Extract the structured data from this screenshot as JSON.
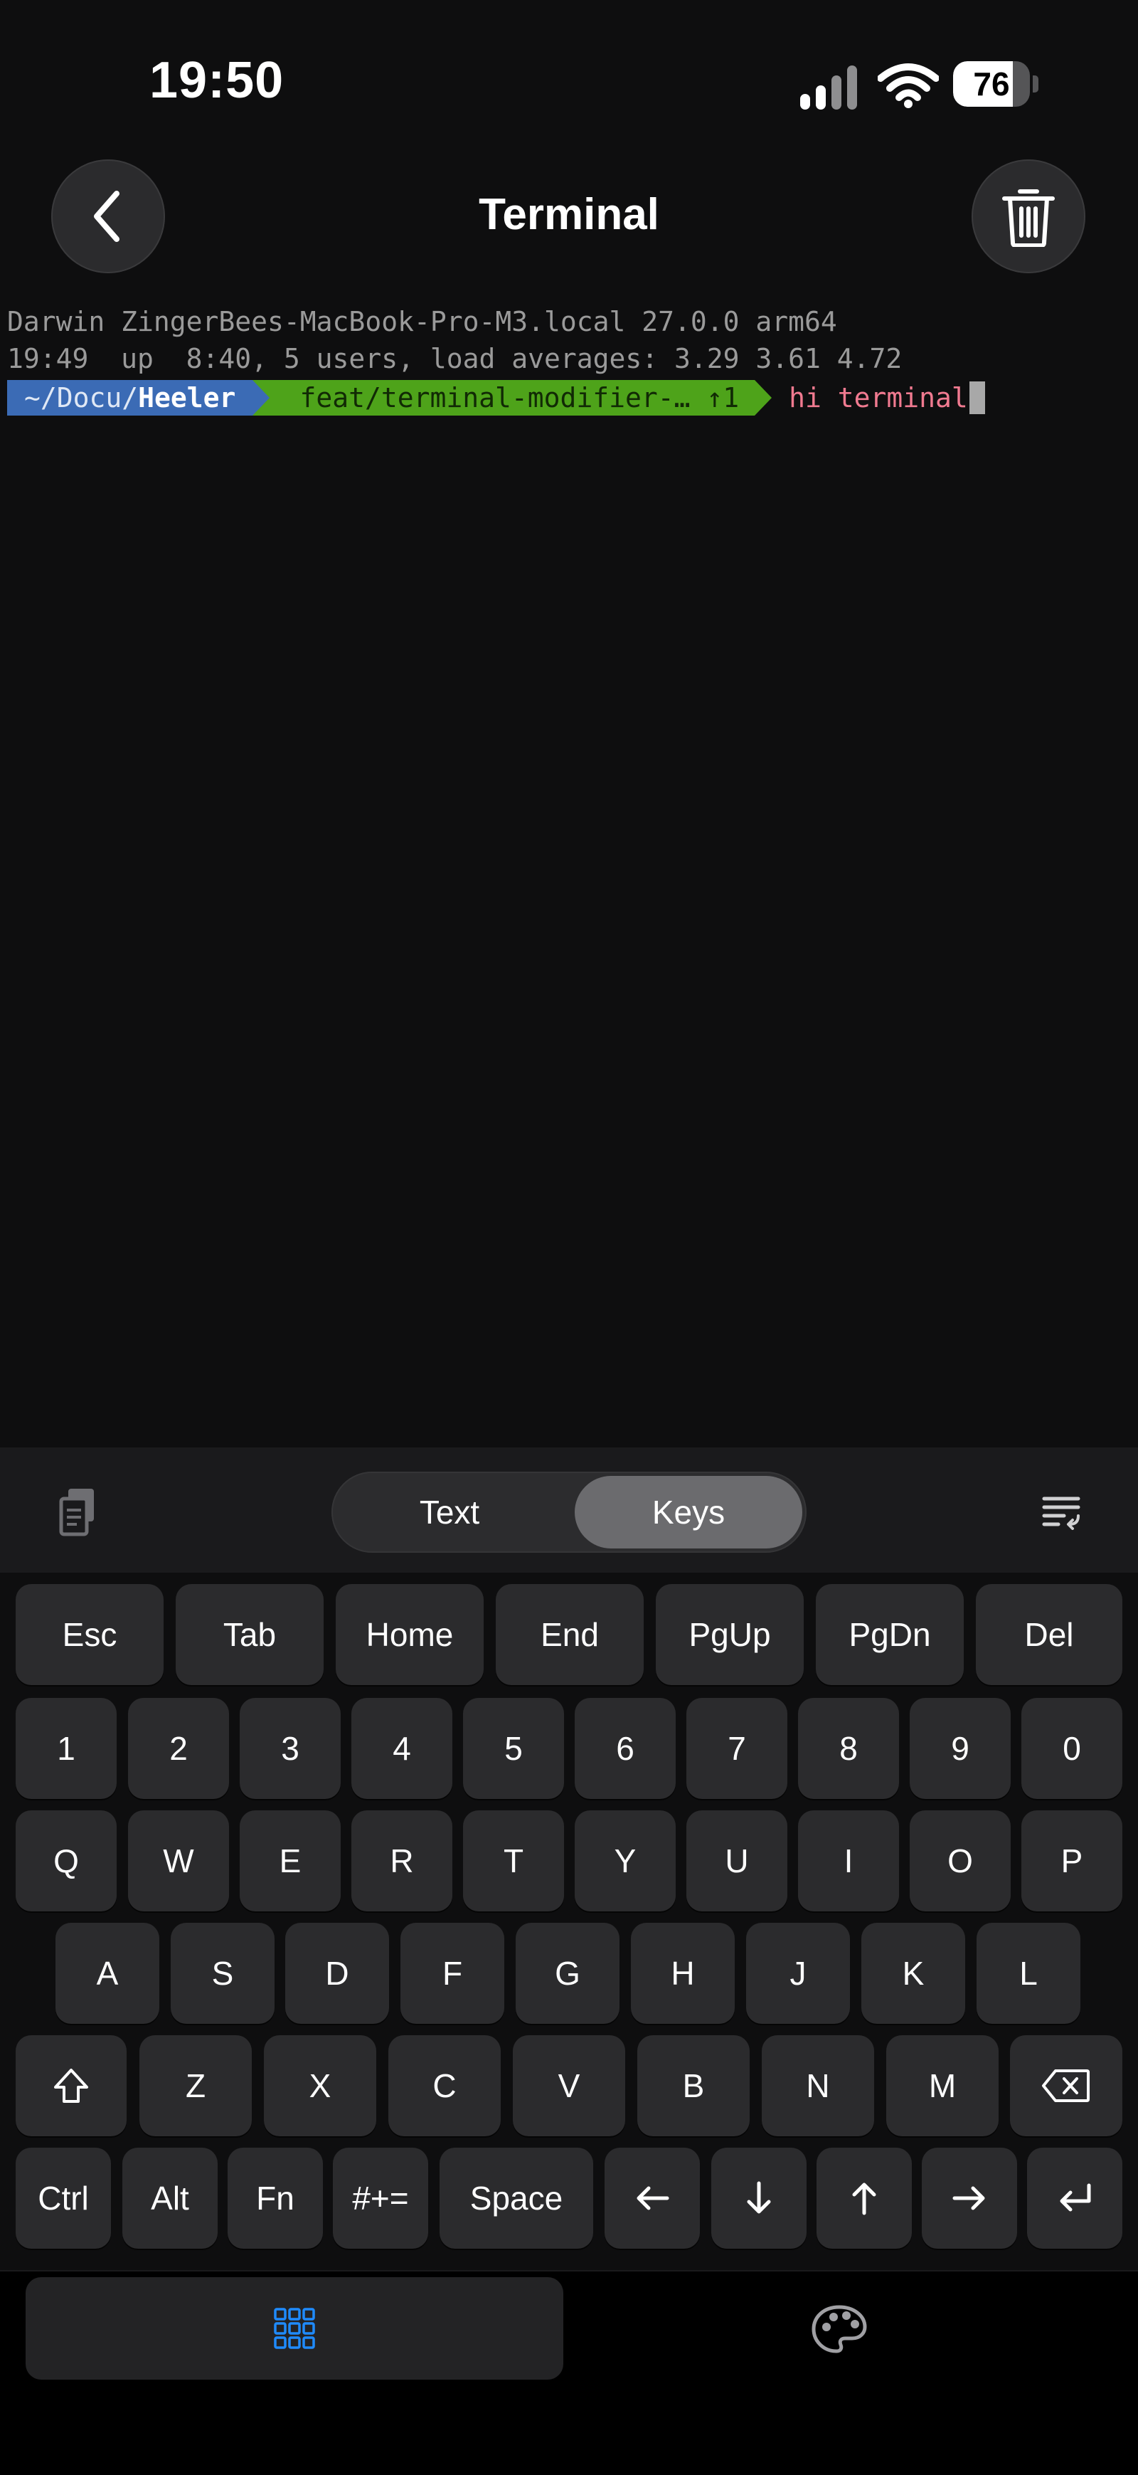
{
  "status_bar": {
    "time": "19:50",
    "battery": "76"
  },
  "header": {
    "title": "Terminal"
  },
  "terminal": {
    "lines": [
      "Darwin ZingerBees-MacBook-Pro-M3.local 27.0.0 arm64",
      "19:49  up  8:40, 5 users, load averages: 3.29 3.61 4.72"
    ],
    "prompt_path_dim": "~/Docu/",
    "prompt_path_bold": "Heeler",
    "prompt_git": "feat/terminal-modifier-… ↑1",
    "command": "hi terminal"
  },
  "accessory": {
    "mode_text": "Text",
    "mode_keys": "Keys"
  },
  "keyboard": {
    "nav_row": [
      "Esc",
      "Tab",
      "Home",
      "End",
      "PgUp",
      "PgDn",
      "Del"
    ],
    "number_row": [
      "1",
      "2",
      "3",
      "4",
      "5",
      "6",
      "7",
      "8",
      "9",
      "0"
    ],
    "row_q": [
      "Q",
      "W",
      "E",
      "R",
      "T",
      "Y",
      "U",
      "I",
      "O",
      "P"
    ],
    "row_a": [
      "A",
      "S",
      "D",
      "F",
      "G",
      "H",
      "J",
      "K",
      "L"
    ],
    "row_z": [
      "Z",
      "X",
      "C",
      "V",
      "B",
      "N",
      "M"
    ],
    "mod_row": [
      "Ctrl",
      "Alt",
      "Fn",
      "#+=",
      "Space"
    ]
  },
  "colors": {
    "accent_blue": "#1f8bff",
    "path_segment": "#3b6bb5",
    "git_segment": "#4ea31a",
    "command_text": "#f07a90"
  }
}
